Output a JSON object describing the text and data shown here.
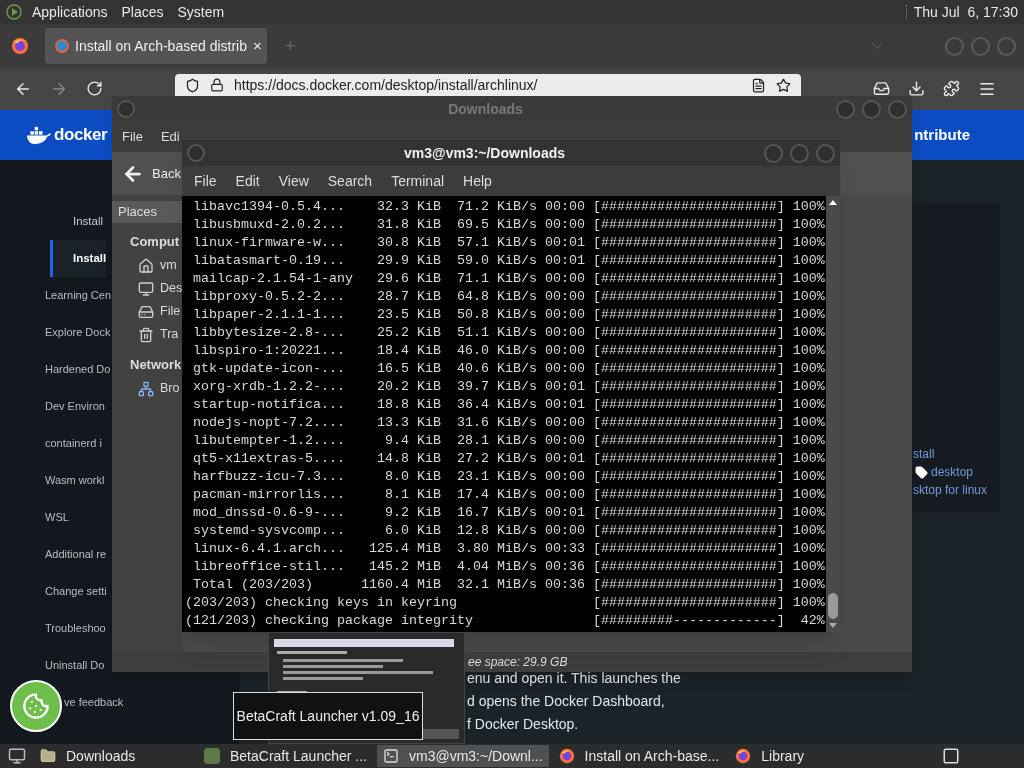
{
  "top_panel": {
    "menus": [
      "Applications",
      "Places",
      "System"
    ],
    "clock": "Thu Jul  6, 17:30"
  },
  "browser": {
    "tabs": [
      {
        "title": "Install on Arch-based distrib",
        "close": "×",
        "selected": true
      }
    ],
    "new_tab": "+",
    "url": "https://docs.docker.com/desktop/install/archlinux/",
    "page": {
      "logo": "docker",
      "header_link": "ntribute",
      "sidebar": [
        {
          "label": "Install",
          "kind": "subitem",
          "selected": false
        },
        {
          "label": "Install",
          "kind": "subitem",
          "selected": true
        },
        {
          "label": "Learning Cen",
          "kind": "item",
          "selected": false
        },
        {
          "label": "Explore Dock",
          "kind": "item",
          "selected": false
        },
        {
          "label": "Hardened Do",
          "kind": "item",
          "selected": false
        },
        {
          "label": "Dev Environ",
          "kind": "item",
          "selected": false
        },
        {
          "label": "containerd i",
          "kind": "item",
          "selected": false
        },
        {
          "label": "Wasm workl",
          "kind": "item",
          "selected": false
        },
        {
          "label": "WSL",
          "kind": "item",
          "selected": false
        },
        {
          "label": "Additional re",
          "kind": "item",
          "selected": false
        },
        {
          "label": "Change setti",
          "kind": "item",
          "selected": false
        },
        {
          "label": "Troubleshoo",
          "kind": "item",
          "selected": false
        },
        {
          "label": "Uninstall Do",
          "kind": "item",
          "selected": false
        },
        {
          "label": "ve feedback",
          "kind": "partial",
          "selected": false
        }
      ],
      "body_lines": [
        "enu and open it. This launches the",
        "d opens the Docker Dashboard,",
        "f Docker Desktop."
      ],
      "tags_heading": "stall",
      "tag": "desktop",
      "related": "sktop for linux"
    }
  },
  "file_manager": {
    "title": "Downloads",
    "menu": [
      "File",
      "Edi"
    ],
    "back": "Back",
    "places_label": "Places",
    "sections": [
      {
        "heading": "Comput",
        "items": [
          {
            "label": "vm",
            "kind": "home"
          },
          {
            "label": "Des",
            "kind": "desktop"
          },
          {
            "label": "File",
            "kind": "drive"
          },
          {
            "label": "Tra",
            "kind": "trash"
          }
        ]
      },
      {
        "heading": "Network",
        "items": [
          {
            "label": "Bro",
            "kind": "network"
          }
        ]
      }
    ],
    "status": "ee space: 29.9 GB"
  },
  "terminal": {
    "title": "vm3@vm3:~/Downloads",
    "menu": [
      "File",
      "Edit",
      "View",
      "Search",
      "Terminal",
      "Help"
    ],
    "lines": [
      " libavc1394-0.5.4...    32.3 KiB  71.2 KiB/s 00:00 [######################] 100%",
      " libusbmuxd-2.0.2...    31.8 KiB  69.5 KiB/s 00:00 [######################] 100%",
      " linux-firmware-w...    30.8 KiB  57.1 KiB/s 00:01 [######################] 100%",
      " libatasmart-0.19...    29.9 KiB  59.0 KiB/s 00:01 [######################] 100%",
      " mailcap-2.1.54-1-any   29.6 KiB  71.1 KiB/s 00:00 [######################] 100%",
      " libproxy-0.5.2-2...    28.7 KiB  64.8 KiB/s 00:00 [######################] 100%",
      " libpaper-2.1.1-1...    23.5 KiB  50.8 KiB/s 00:00 [######################] 100%",
      " libbytesize-2.8-...    25.2 KiB  51.1 KiB/s 00:00 [######################] 100%",
      " libspiro-1:20221...    18.4 KiB  46.0 KiB/s 00:00 [######################] 100%",
      " gtk-update-icon-...    16.5 KiB  40.6 KiB/s 00:00 [######################] 100%",
      " xorg-xrdb-1.2.2-...    20.2 KiB  39.7 KiB/s 00:01 [######################] 100%",
      " startup-notifica...    18.8 KiB  36.4 KiB/s 00:01 [######################] 100%",
      " nodejs-nopt-7.2....    13.3 KiB  31.6 KiB/s 00:00 [######################] 100%",
      " libutempter-1.2....     9.4 KiB  28.1 KiB/s 00:00 [######################] 100%",
      " qt5-x11extras-5....    14.8 KiB  27.2 KiB/s 00:01 [######################] 100%",
      " harfbuzz-icu-7.3...     8.0 KiB  23.1 KiB/s 00:00 [######################] 100%",
      " pacman-mirrorlis...     8.1 KiB  17.4 KiB/s 00:00 [######################] 100%",
      " mod_dnssd-0.6-9-...     9.2 KiB  16.7 KiB/s 00:01 [######################] 100%",
      " systemd-sysvcomp...     6.0 KiB  12.8 KiB/s 00:00 [######################] 100%",
      " linux-6.4.1.arch...   125.4 MiB  3.80 MiB/s 00:33 [######################] 100%",
      " libreoffice-stil...   145.2 MiB  4.04 MiB/s 00:36 [######################] 100%",
      " Total (203/203)      1160.4 MiB  32.1 MiB/s 00:36 [######################] 100%",
      "(203/203) checking keys in keyring                 [######################] 100%",
      "(121/203) checking package integrity               [#########-------------]  42%"
    ]
  },
  "tooltip": "BetaCraft Launcher v1.09_16",
  "taskbar": {
    "items": [
      {
        "label": "Downloads",
        "kind": "folder",
        "selected": false
      },
      {
        "label": "BetaCraft Launcher ...",
        "kind": "launcher",
        "selected": false
      },
      {
        "label": "vm3@vm3:~/Downl...",
        "kind": "terminal",
        "selected": true
      },
      {
        "label": "Install on Arch-base...",
        "kind": "firefox",
        "selected": false
      },
      {
        "label": "Library",
        "kind": "firefox",
        "selected": false
      }
    ]
  }
}
